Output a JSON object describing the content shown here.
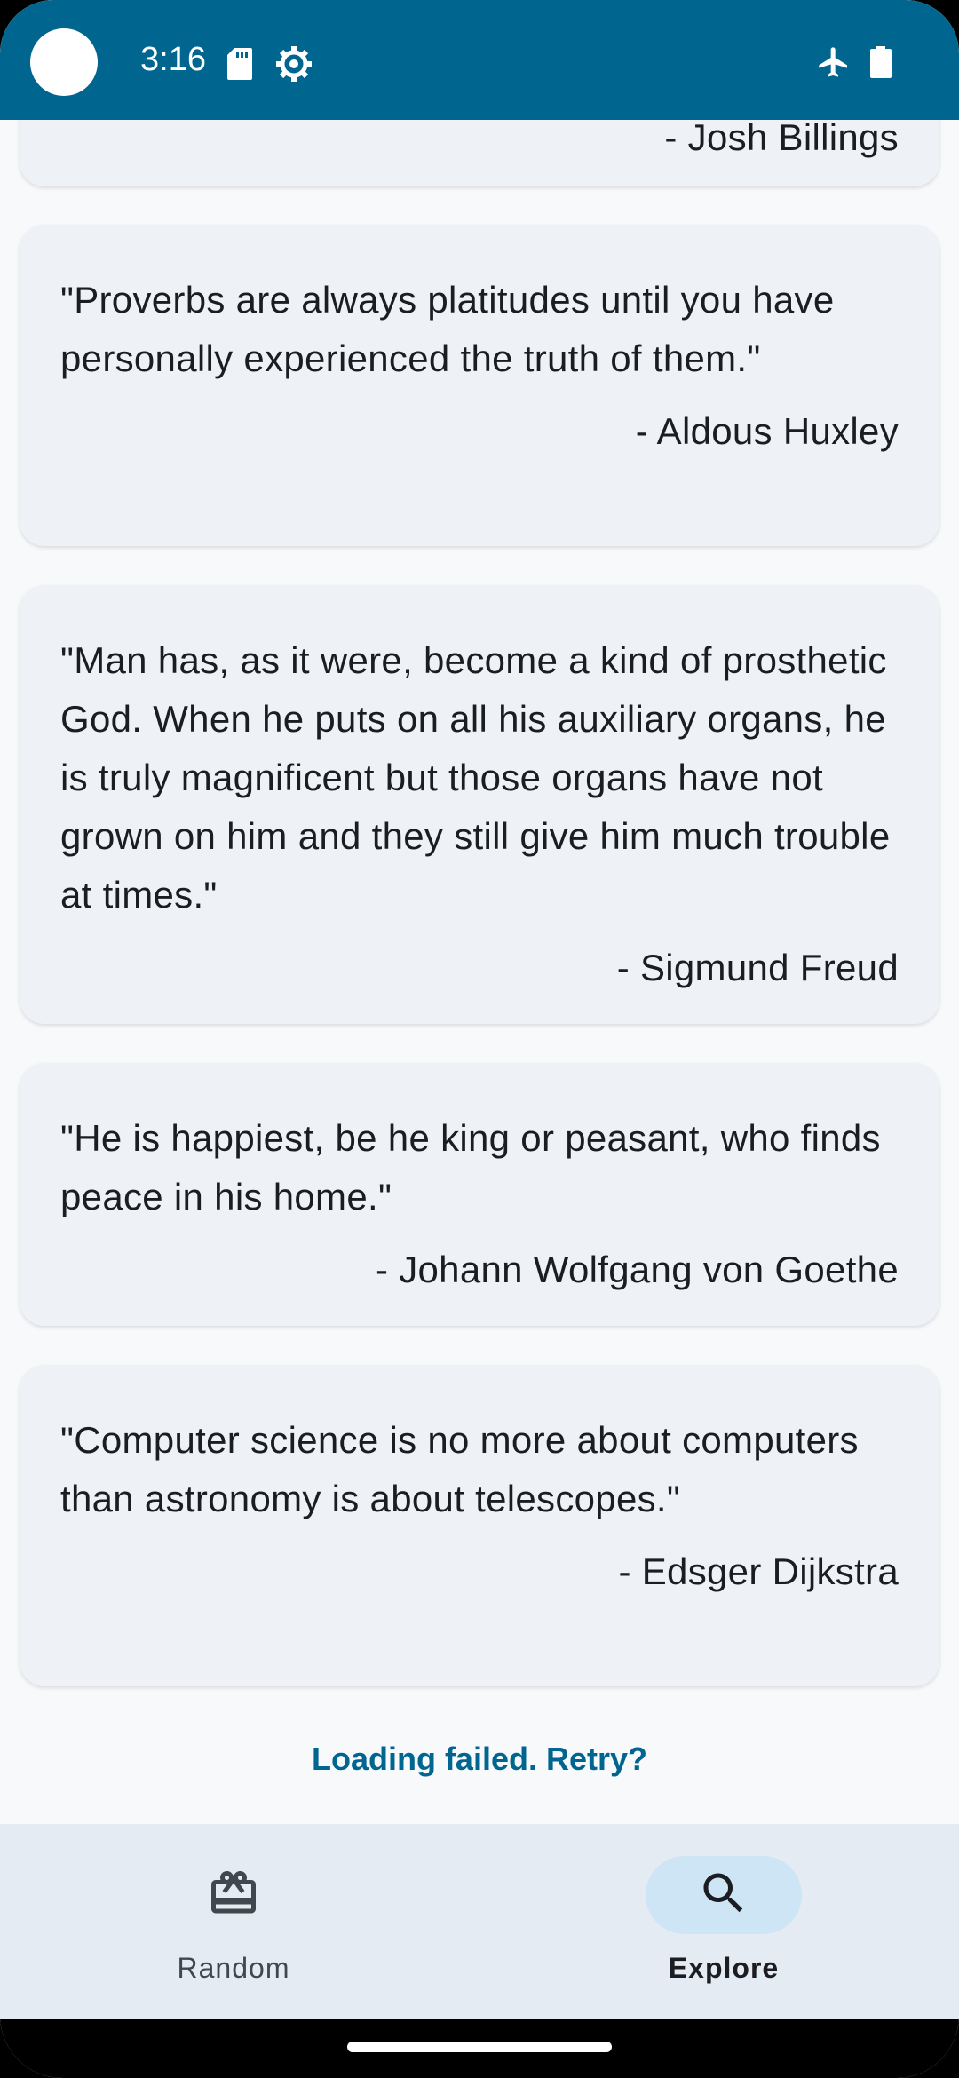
{
  "status_bar": {
    "time": "3:16",
    "icons": [
      "sd-card-icon",
      "settings-gear-icon",
      "airplane-mode-icon",
      "battery-icon"
    ]
  },
  "quotes": [
    {
      "text": "",
      "author": "- Josh Billings"
    },
    {
      "text": "\"Proverbs are always platitudes until you have personally experienced the truth of them.\"",
      "author": "- Aldous Huxley"
    },
    {
      "text": "\"Man has, as it were, become a kind of prosthetic God. When he puts on all his auxiliary organs, he is truly magnificent but those organs have not grown on him and they still give him much trouble at times.\"",
      "author": "- Sigmund Freud"
    },
    {
      "text": "\"He is happiest, be he king or peasant, who finds peace in his home.\"",
      "author": "- Johann Wolfgang von Goethe"
    },
    {
      "text": "\"Computer science is no more about computers than astronomy is about telescopes.\"",
      "author": "- Edsger Dijkstra"
    }
  ],
  "retry_label": "Loading failed. Retry?",
  "bottom_nav": {
    "items": [
      {
        "label": "Random",
        "icon": "cards-icon",
        "selected": false
      },
      {
        "label": "Explore",
        "icon": "search-icon",
        "selected": true
      }
    ]
  },
  "colors": {
    "primary": "#00658f",
    "card_background": "#eef2f6",
    "nav_background": "#e5ebf2",
    "nav_indicator": "#cde5f5"
  }
}
